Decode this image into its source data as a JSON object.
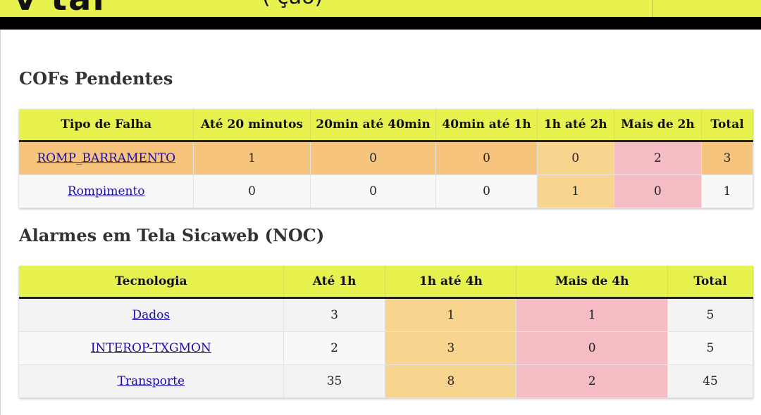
{
  "header": {
    "logo_text": "v tal",
    "clipped_title": "(                    ção)"
  },
  "colors": {
    "header_yellow": "#e8f24e",
    "cell_orange": "#f6c47c",
    "cell_light_orange": "#f8d58f",
    "cell_pink": "#f5bcc4",
    "link_blue": "#1a0dab"
  },
  "cof": {
    "title": "COFs Pendentes",
    "headers": [
      "Tipo de Falha",
      "Até 20 minutos",
      "20min até 40min",
      "40min até 1h",
      "1h até 2h",
      "Mais de 2h",
      "Total"
    ],
    "rows": [
      {
        "name": "ROMP_BARRAMENTO",
        "values": [
          "1",
          "0",
          "0",
          "0",
          "2",
          "3"
        ]
      },
      {
        "name": "Rompimento",
        "values": [
          "0",
          "0",
          "0",
          "1",
          "0",
          "1"
        ]
      }
    ]
  },
  "noc": {
    "title": "Alarmes em Tela Sicaweb (NOC)",
    "headers": [
      "Tecnologia",
      "Até 1h",
      "1h até 4h",
      "Mais de 4h",
      "Total"
    ],
    "rows": [
      {
        "name": "Dados",
        "values": [
          "3",
          "1",
          "1",
          "5"
        ]
      },
      {
        "name": "INTEROP-TXGMON",
        "values": [
          "2",
          "3",
          "0",
          "5"
        ]
      },
      {
        "name": "Transporte",
        "values": [
          "35",
          "8",
          "2",
          "45"
        ]
      }
    ]
  }
}
